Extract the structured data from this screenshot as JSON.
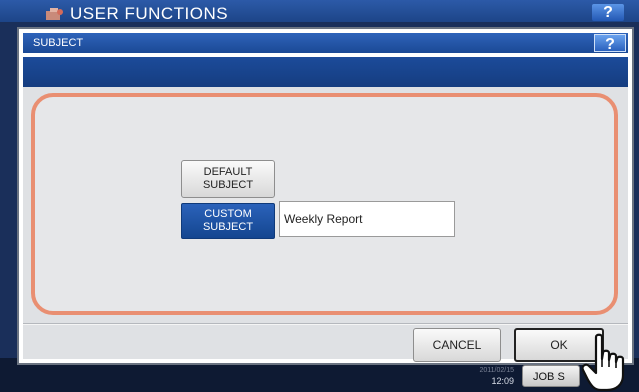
{
  "background_screen": {
    "title": "USER FUNCTIONS",
    "help_label": "?",
    "clock_date": "2011/02/15",
    "clock_time": "12:09",
    "job_status_label": "JOB S"
  },
  "dialog": {
    "title": "SUBJECT",
    "help_label": "?",
    "default_subject_label": [
      "DEFAULT",
      "SUBJECT"
    ],
    "custom_subject_label": [
      "CUSTOM",
      "SUBJECT"
    ],
    "custom_subject_value": "Weekly Report",
    "cancel_label": "CANCEL",
    "ok_label": "OK"
  },
  "colors": {
    "title_bar": "#1b4995",
    "panel_border": "#e98f72",
    "selected_button": "#144690",
    "dialog_body": "#dfe1e4"
  },
  "icons": {
    "logo": "user-functions-logo-icon",
    "cursor": "pointing-hand-icon"
  }
}
